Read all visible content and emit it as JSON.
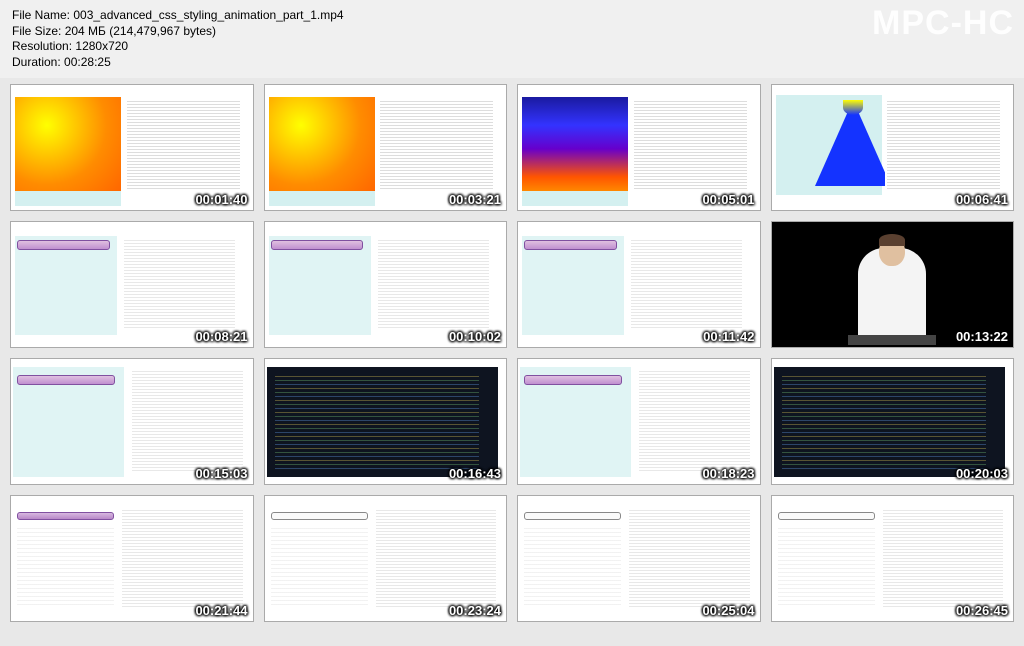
{
  "watermark": "MPC-HC",
  "file_info": {
    "name_label": "File Name:",
    "name_value": "003_advanced_css_styling_animation_part_1.mp4",
    "size_label": "File Size:",
    "size_value": "204 МБ (214,479,967 bytes)",
    "resolution_label": "Resolution:",
    "resolution_value": "1280x720",
    "duration_label": "Duration:",
    "duration_value": "00:28:25"
  },
  "thumbs": [
    {
      "ts": "00:01:40"
    },
    {
      "ts": "00:03:21"
    },
    {
      "ts": "00:05:01"
    },
    {
      "ts": "00:06:41"
    },
    {
      "ts": "00:08:21"
    },
    {
      "ts": "00:10:02"
    },
    {
      "ts": "00:11:42"
    },
    {
      "ts": "00:13:22"
    },
    {
      "ts": "00:15:03"
    },
    {
      "ts": "00:16:43"
    },
    {
      "ts": "00:18:23"
    },
    {
      "ts": "00:20:03"
    },
    {
      "ts": "00:21:44"
    },
    {
      "ts": "00:23:24"
    },
    {
      "ts": "00:25:04"
    },
    {
      "ts": "00:26:45"
    }
  ]
}
